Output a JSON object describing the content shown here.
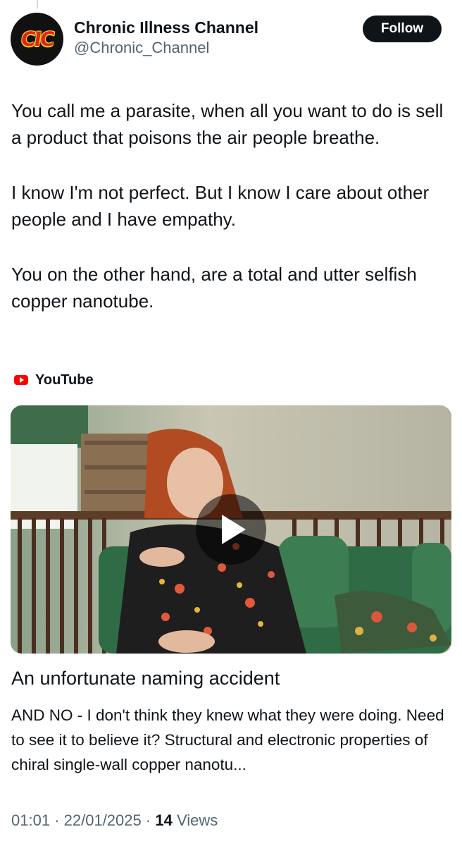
{
  "author": {
    "display_name": "Chronic Illness Channel",
    "handle": "@Chronic_Channel",
    "avatar_text": "CIC"
  },
  "follow_label": "Follow",
  "tweet": {
    "paragraphs": [
      "You call me a parasite, when all you want to do is sell a product that poisons the air people breathe.",
      "I know I'm not perfect.  But I know I care about other people and I have empathy.",
      "You on the other hand, are a total and utter selfish copper nanotube."
    ]
  },
  "card": {
    "source": "YouTube",
    "source_icon": "youtube-icon",
    "title": "An unfortunate naming accident",
    "description": "AND NO - I don't think they knew what they were doing. Need to see it to believe it? Structural and electronic properties of chiral single-wall copper nanotu..."
  },
  "meta": {
    "time": "01:01",
    "separator": "·",
    "date": "22/01/2025",
    "views_count": "14",
    "views_label": "Views"
  },
  "colors": {
    "text": "#0f1419",
    "secondary": "#536471",
    "youtube_red": "#ff0000"
  }
}
